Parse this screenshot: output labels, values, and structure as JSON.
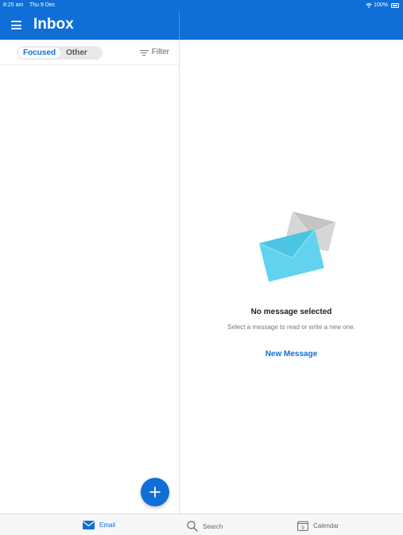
{
  "status_bar": {
    "time": "8:25 am",
    "date": "Thu 9 Dec",
    "battery": "100%"
  },
  "header": {
    "title": "Inbox"
  },
  "inbox_tabs": {
    "focused": "Focused",
    "other": "Other"
  },
  "filter": {
    "label": "Filter"
  },
  "reading_pane": {
    "empty_title": "No message selected",
    "empty_subtitle": "Select a message to read or write a new one.",
    "new_message": "New Message"
  },
  "bottom_nav": [
    {
      "label": "Email",
      "icon": "envelope-icon",
      "active": true
    },
    {
      "label": "Search",
      "icon": "search-icon",
      "active": false
    },
    {
      "label": "Calendar",
      "icon": "calendar-icon",
      "active": false
    }
  ],
  "calendar_day": "9",
  "colors": {
    "accent": "#0f6fd6",
    "envelope_front": "#62d3ee",
    "envelope_back": "#d6d6d6"
  },
  "fab": {
    "icon": "plus-icon"
  }
}
